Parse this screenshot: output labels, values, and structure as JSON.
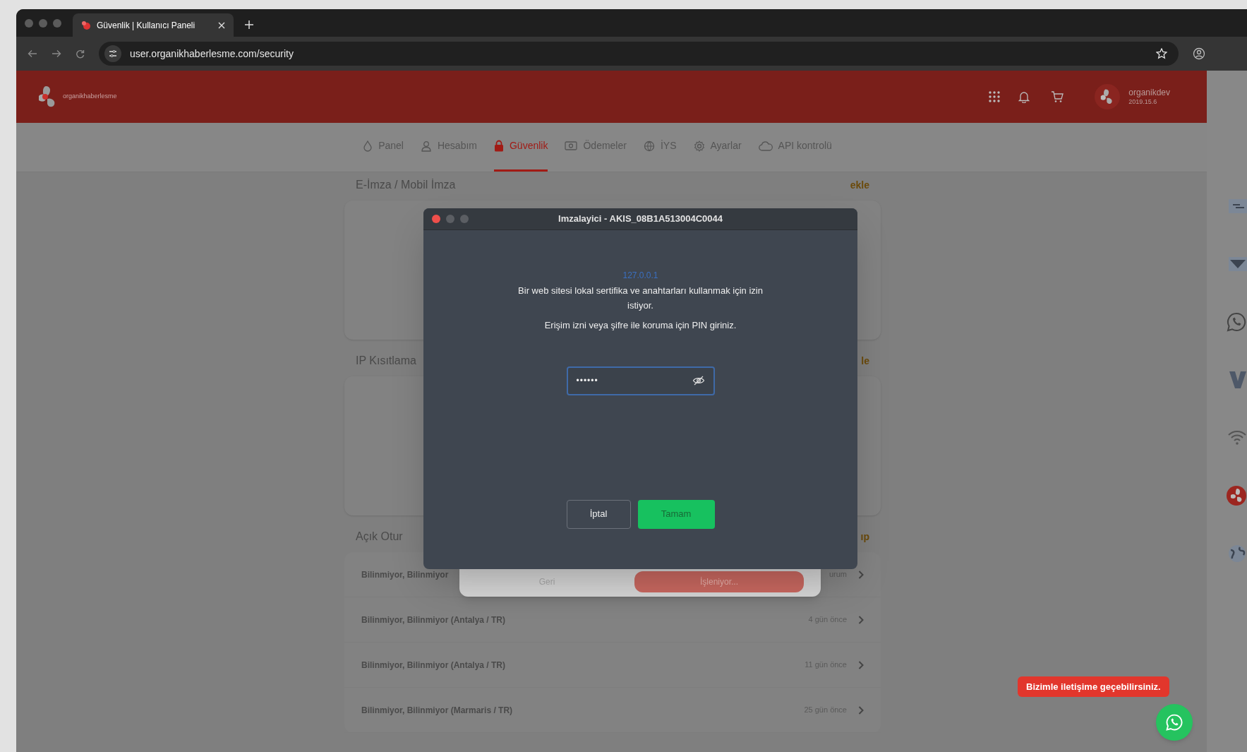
{
  "browser": {
    "tab_title": "Güvenlik | Kullanıcı Paneli",
    "url": "user.organikhaberlesme.com/security"
  },
  "header": {
    "logo_text": "organikhaberlesme",
    "user_name": "organikdev",
    "user_id": "2019.15.6"
  },
  "nav_tabs": [
    {
      "label": "Panel",
      "kind": "drop",
      "selected": false
    },
    {
      "label": "Hesabım",
      "kind": "user",
      "selected": false
    },
    {
      "label": "Güvenlik",
      "kind": "lock",
      "selected": true
    },
    {
      "label": "Ödemeler",
      "kind": "money",
      "selected": false
    },
    {
      "label": "İYS",
      "kind": "globe",
      "selected": false
    },
    {
      "label": "Ayarlar",
      "kind": "gear",
      "selected": false
    },
    {
      "label": "API kontrolü",
      "kind": "cloud",
      "selected": false
    }
  ],
  "sections": [
    {
      "title": "E-İmza / Mobil İmza",
      "action": "ekle",
      "kind": "card"
    },
    {
      "title": "IP Kısıtlama",
      "action": "le",
      "kind": "card"
    },
    {
      "title": "Açık Otur",
      "action": "ıp",
      "kind": "list"
    }
  ],
  "sessions": [
    {
      "location": "Bilinmiyor, Bilinmiyor",
      "time": "urum"
    },
    {
      "location": "Bilinmiyor, Bilinmiyor (Antalya / TR)",
      "time": "4 gün önce"
    },
    {
      "location": "Bilinmiyor, Bilinmiyor (Antalya / TR)",
      "time": "11 gün önce"
    },
    {
      "location": "Bilinmiyor, Bilinmiyor (Marmaris / TR)",
      "time": "25 gün önce"
    }
  ],
  "back_dialog": {
    "back_button": "Geri",
    "processing_button": "İşleniyor..."
  },
  "signer_dialog": {
    "title": "Imzalayici - AKIS_08B1A513004C0044",
    "host": "127.0.0.1",
    "message": "Bir web sitesi lokal sertifika ve anahtarları kullanmak için izin istiyor.",
    "prompt": "Erişim izni veya şifre ile koruma için PIN giriniz.",
    "pin_value": "••••••",
    "cancel_button": "İptal",
    "ok_button": "Tamam"
  },
  "contact_bubble": "Bizimle iletişime geçebilirsiniz."
}
